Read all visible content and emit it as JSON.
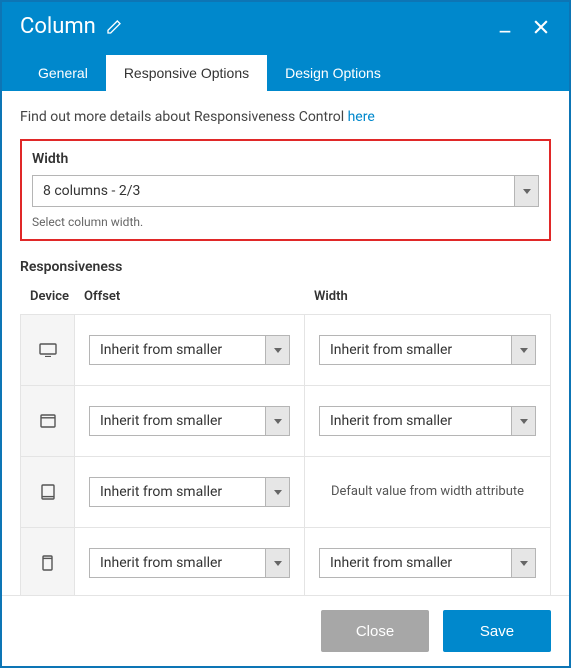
{
  "header": {
    "title": "Column"
  },
  "tabs": {
    "general": "General",
    "responsive": "Responsive Options",
    "design": "Design Options",
    "active": "responsive"
  },
  "helper": {
    "text_prefix": "Find out more details about Responsiveness Control ",
    "link": "here"
  },
  "width_section": {
    "label": "Width",
    "value": "8 columns - 2/3",
    "hint": "Select column width."
  },
  "responsiveness": {
    "heading": "Responsiveness",
    "columns": {
      "device": "Device",
      "offset": "Offset",
      "width": "Width"
    },
    "inherit_label": "Inherit from smaller",
    "default_text": "Default value from width attribute",
    "rows": [
      {
        "device": "desktop-wide",
        "offset": "inherit",
        "width": "inherit"
      },
      {
        "device": "desktop",
        "offset": "inherit",
        "width": "inherit"
      },
      {
        "device": "tablet",
        "offset": "inherit",
        "width": "default"
      },
      {
        "device": "mobile",
        "offset": "inherit",
        "width": "inherit"
      }
    ]
  },
  "footer": {
    "close": "Close",
    "save": "Save"
  }
}
